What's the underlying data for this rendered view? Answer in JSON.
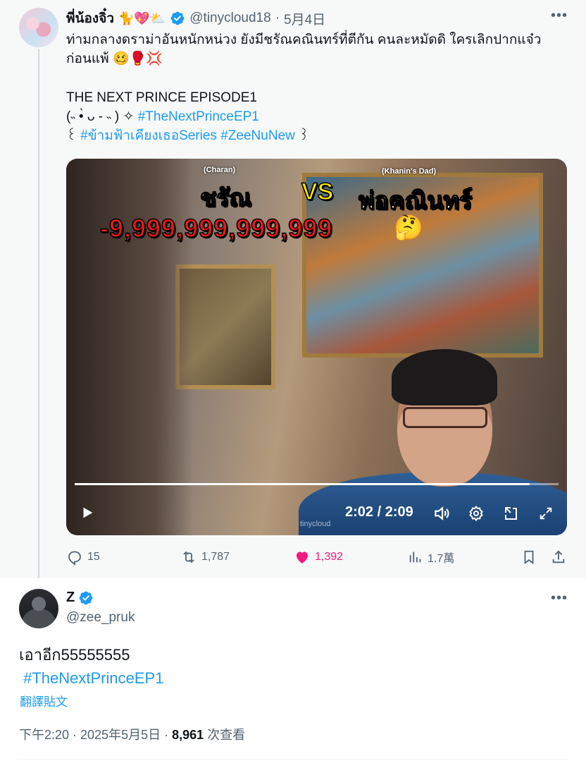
{
  "parent_tweet": {
    "display_name": "พี่น้องจิ๋ว",
    "name_emojis": "🐈💖⛅",
    "handle": "@tinycloud18",
    "date": "5月4日",
    "text_line1": "ท่ามกลางดราม่าอันหนักหน่วง ยังมีชรัณคณินทร์ที่ตีกัน คนละหมัดดิ ใครเลิกปากแจ๋ว",
    "text_line2": "ก่อนแพ้ 🥴🥊💢",
    "text_line3": "THE NEXT PRINCE EPISODE1",
    "text_line4_prefix": "(˵ •̀ ᴗ - ˵ ) ✧ ",
    "hashtag1": "#TheNextPrinceEP1",
    "text_line5_prefix": "꒰ ",
    "hashtag2": "#ข้ามฟ้าเคียงเธอSeries",
    "hashtag3": "#ZeeNuNew",
    "text_line5_suffix": " ꒱",
    "video": {
      "label_left": "(Charan)",
      "label_right": "(Khanin's Dad)",
      "name_left": "ชรัณ",
      "vs": "VS",
      "name_right": "พ่อคณินทร์",
      "score": "-9,999,999,999,999",
      "emoji": "🤔",
      "time": "2:02 / 2:09",
      "watermark": "tinycloud",
      "progress": 0.94
    },
    "actions": {
      "replies": "15",
      "retweets": "1,787",
      "likes": "1,392",
      "views": "1.7萬"
    }
  },
  "main_tweet": {
    "display_name": "Z",
    "handle": "@zee_pruk",
    "text": "เอาอีก55555555",
    "hashtag": "#TheNextPrinceEP1",
    "translate": "翻譯貼文",
    "time": "下午2:20",
    "date": "2025年5月5日",
    "views_count": "8,961",
    "views_label": "次查看"
  },
  "colors": {
    "accent": "#1d9bf0",
    "like": "#f91880",
    "secondary": "#536471"
  }
}
